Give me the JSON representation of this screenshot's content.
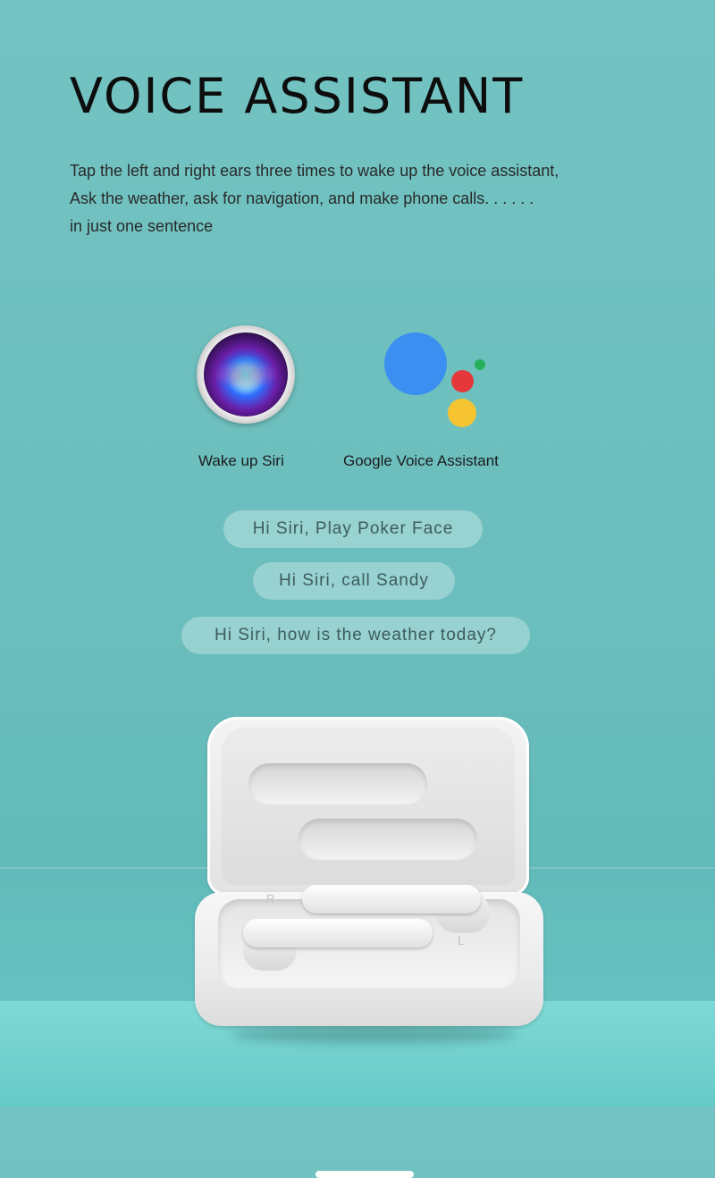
{
  "heading": {
    "title": "VOICE ASSISTANT",
    "lines": [
      "Tap the left and right ears three times to wake up the voice assistant,",
      "Ask the weather, ask for navigation, and make phone calls. . . . . .",
      "in just one sentence"
    ]
  },
  "assistants": {
    "siri": {
      "label": "Wake up Siri",
      "icon": "siri-icon"
    },
    "google": {
      "label": "Google Voice Assistant",
      "icon": "google-assistant-icon"
    }
  },
  "bubbles": [
    "Hi Siri, Play Poker Face",
    "Hi Siri, call Sandy",
    "Hi Siri, how is the weather today?"
  ],
  "product": {
    "right_mark": "R",
    "left_mark": "L"
  },
  "colors": {
    "background": "#6bbebd",
    "google_blue": "#3b8ff0",
    "google_red": "#e5383b",
    "google_yellow": "#f6c431",
    "google_green": "#23b25a"
  }
}
